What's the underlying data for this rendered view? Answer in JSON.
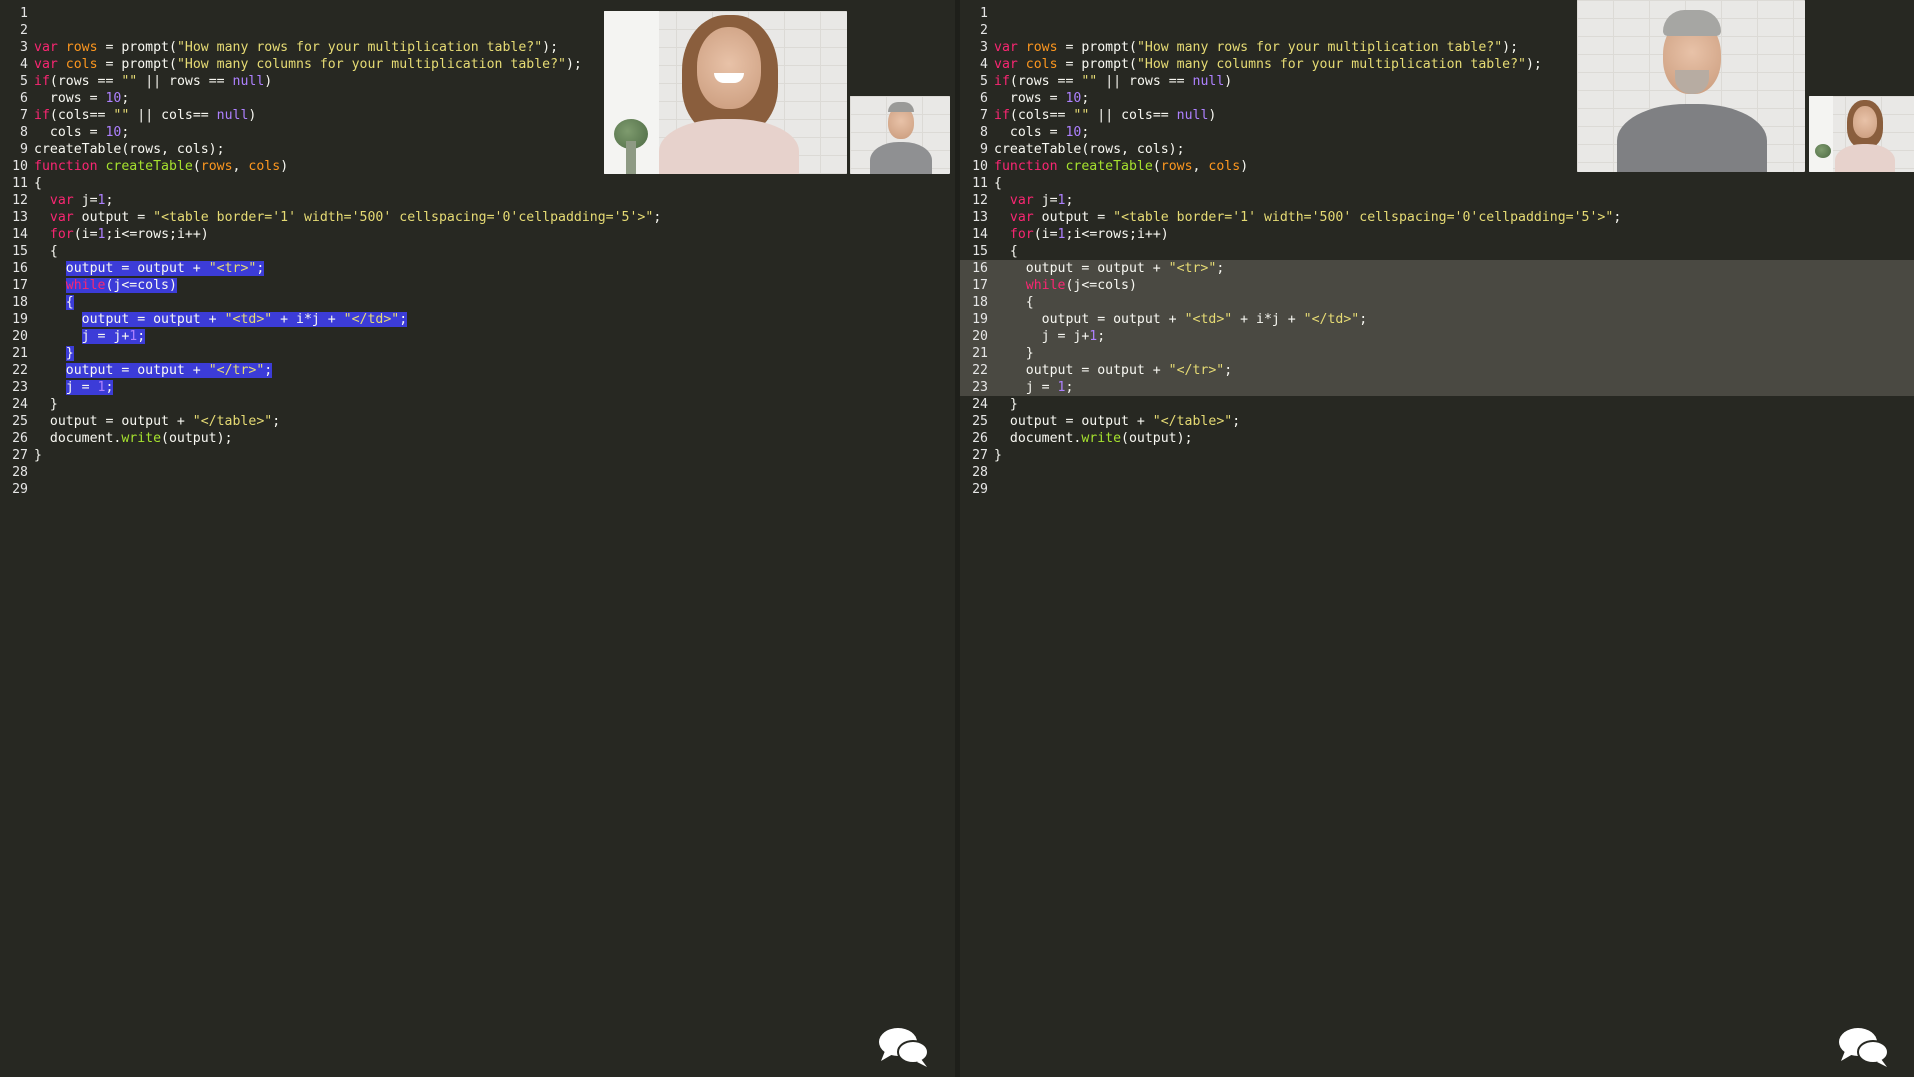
{
  "code_lines": [
    [],
    [],
    [
      [
        "kw",
        "var "
      ],
      [
        "var",
        "rows"
      ],
      [
        "pl",
        " = prompt("
      ],
      [
        "str",
        "\"How many rows for your multiplication table?\""
      ],
      [
        "pl",
        ");"
      ]
    ],
    [
      [
        "kw",
        "var "
      ],
      [
        "var",
        "cols"
      ],
      [
        "pl",
        " = prompt("
      ],
      [
        "str",
        "\"How many columns for your multiplication table?\""
      ],
      [
        "pl",
        ");"
      ]
    ],
    [
      [
        "kw",
        "if"
      ],
      [
        "pl",
        "(rows == "
      ],
      [
        "str",
        "\"\""
      ],
      [
        "pl",
        " || rows == "
      ],
      [
        "num",
        "null"
      ],
      [
        "pl",
        ")"
      ]
    ],
    [
      [
        "pl",
        "  rows = "
      ],
      [
        "num",
        "10"
      ],
      [
        "pl",
        ";"
      ]
    ],
    [
      [
        "kw",
        "if"
      ],
      [
        "pl",
        "(cols== "
      ],
      [
        "str",
        "\"\""
      ],
      [
        "pl",
        " || cols== "
      ],
      [
        "num",
        "null"
      ],
      [
        "pl",
        ")"
      ]
    ],
    [
      [
        "pl",
        "  cols = "
      ],
      [
        "num",
        "10"
      ],
      [
        "pl",
        ";"
      ]
    ],
    [
      [
        "pl",
        "createTable(rows, cols);"
      ]
    ],
    [
      [
        "kw",
        "function "
      ],
      [
        "fn",
        "createTable"
      ],
      [
        "pl",
        "("
      ],
      [
        "var",
        "rows"
      ],
      [
        "pl",
        ", "
      ],
      [
        "var",
        "cols"
      ],
      [
        "pl",
        ")"
      ]
    ],
    [
      [
        "pl",
        "{"
      ]
    ],
    [
      [
        "pl",
        "  "
      ],
      [
        "kw",
        "var "
      ],
      [
        "pl",
        "j="
      ],
      [
        "num",
        "1"
      ],
      [
        "pl",
        ";"
      ]
    ],
    [
      [
        "pl",
        "  "
      ],
      [
        "kw",
        "var "
      ],
      [
        "pl",
        "output = "
      ],
      [
        "str",
        "\"<table border='1' width='500' cellspacing='0'cellpadding='5'>\""
      ],
      [
        "pl",
        ";"
      ]
    ],
    [
      [
        "pl",
        "  "
      ],
      [
        "kw",
        "for"
      ],
      [
        "pl",
        "(i="
      ],
      [
        "num",
        "1"
      ],
      [
        "pl",
        ";i<=rows;i++)"
      ]
    ],
    [
      [
        "pl",
        "  {"
      ]
    ],
    [
      [
        "pl",
        "    output = output + "
      ],
      [
        "str",
        "\"<tr>\""
      ],
      [
        "pl",
        ";"
      ]
    ],
    [
      [
        "pl",
        "    "
      ],
      [
        "kw",
        "while"
      ],
      [
        "pl",
        "(j<=cols)"
      ]
    ],
    [
      [
        "pl",
        "    {"
      ]
    ],
    [
      [
        "pl",
        "      output = output + "
      ],
      [
        "str",
        "\"<td>\""
      ],
      [
        "pl",
        " + i*j + "
      ],
      [
        "str",
        "\"</td>\""
      ],
      [
        "pl",
        ";"
      ]
    ],
    [
      [
        "pl",
        "      j = j+"
      ],
      [
        "num",
        "1"
      ],
      [
        "pl",
        ";"
      ]
    ],
    [
      [
        "pl",
        "    }"
      ]
    ],
    [
      [
        "pl",
        "    output = output + "
      ],
      [
        "str",
        "\"</tr>\""
      ],
      [
        "pl",
        ";"
      ]
    ],
    [
      [
        "pl",
        "    j = "
      ],
      [
        "num",
        "1"
      ],
      [
        "pl",
        ";"
      ]
    ],
    [
      [
        "pl",
        "  }"
      ]
    ],
    [
      [
        "pl",
        "  output = output + "
      ],
      [
        "str",
        "\"</table>\""
      ],
      [
        "pl",
        ";"
      ]
    ],
    [
      [
        "pl",
        "  document."
      ],
      [
        "fn",
        "write"
      ],
      [
        "pl",
        "(output);"
      ]
    ],
    [
      [
        "pl",
        "}"
      ]
    ],
    [],
    []
  ],
  "selection": {
    "start": 16,
    "end": 23
  },
  "colors": {
    "background": "#272822",
    "keyword": "#f92672",
    "variable": "#fd971f",
    "string": "#e6db74",
    "number": "#ae81ff",
    "function": "#a6e22e",
    "selection_left": "#3c3cd8",
    "selection_right": "#4a4942"
  },
  "icons": {
    "chat": "chat-bubbles-icon"
  }
}
